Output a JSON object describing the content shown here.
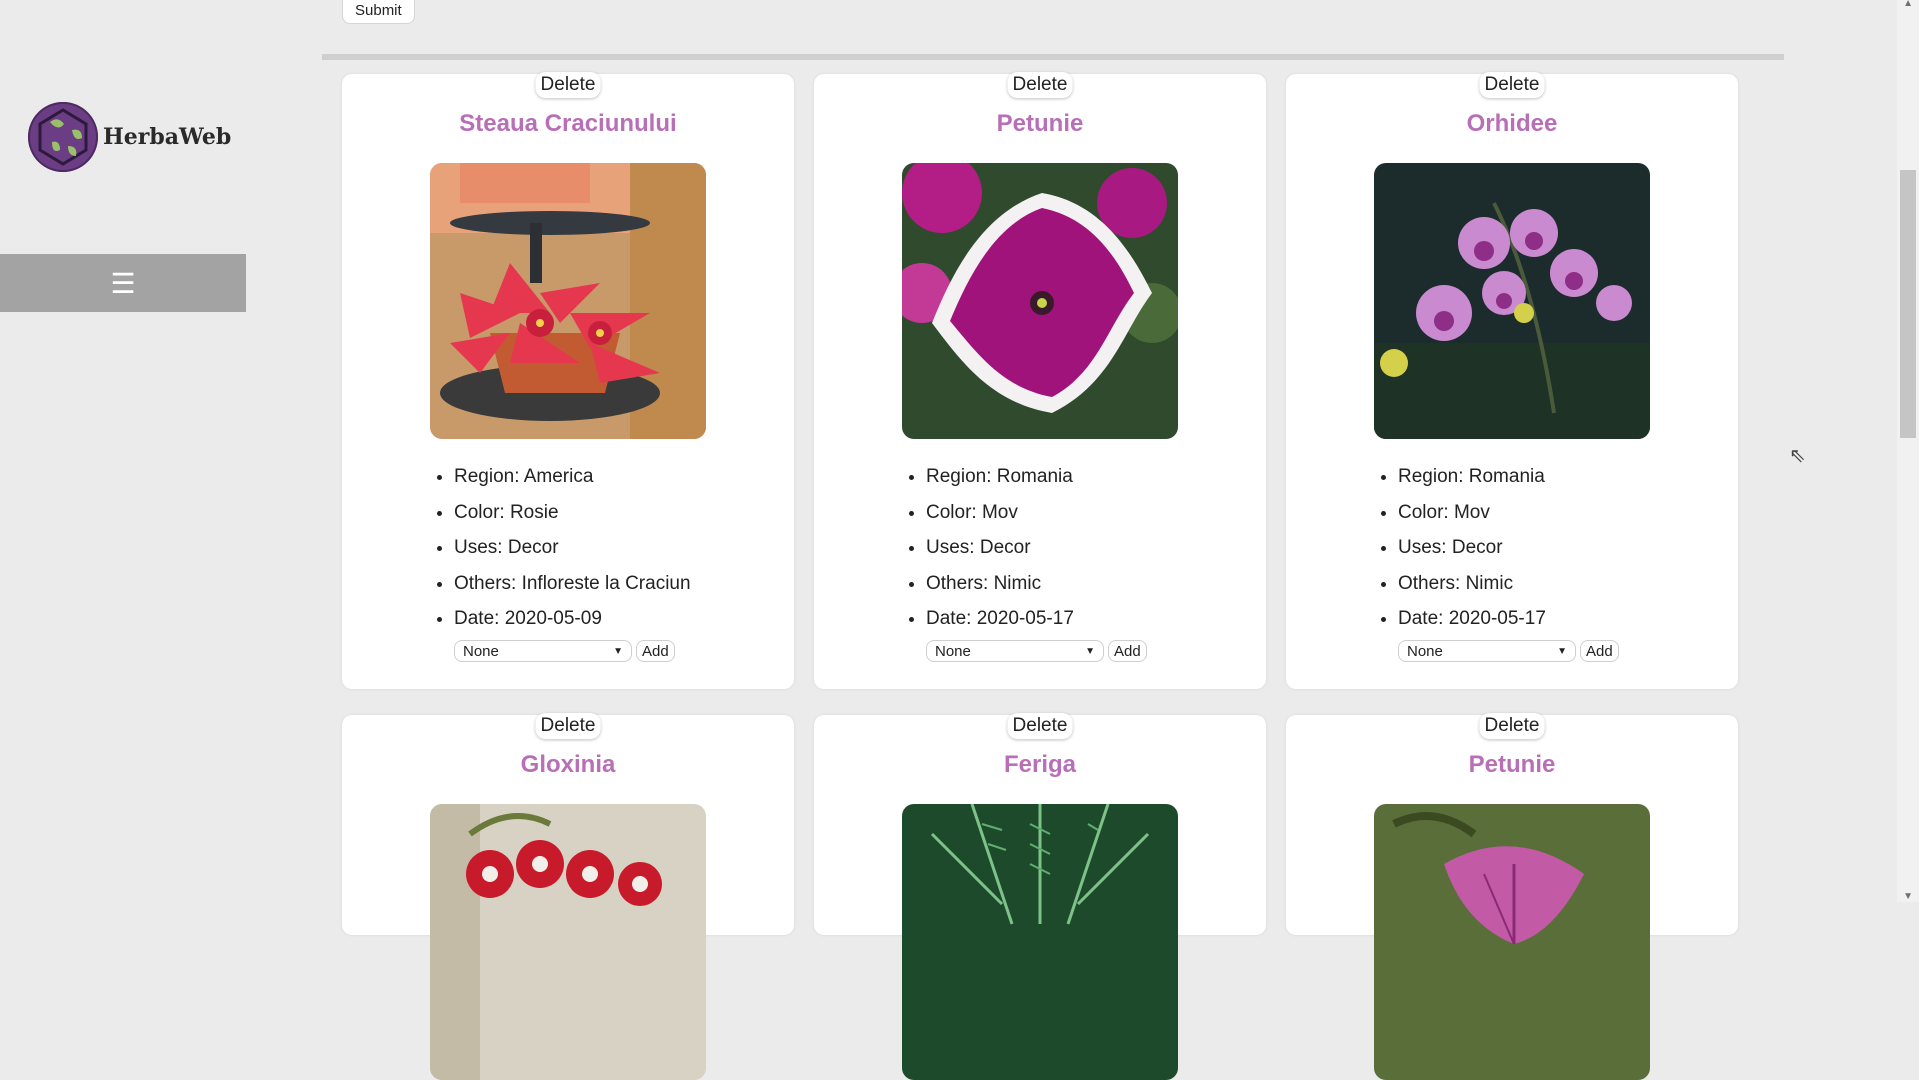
{
  "brand": {
    "name": "HerbaWeb"
  },
  "menu": {
    "icon": "hamburger-icon",
    "glyph": "☰"
  },
  "form": {
    "submit_label": "Submit"
  },
  "cards": [
    {
      "name": "Steaua Craciunului",
      "delete_label": "Delete",
      "image": "poinsettia",
      "details": [
        "Region: America",
        "Color: Rosie",
        "Uses: Decor",
        "Others: Infloreste la Craciun",
        "Date: 2020-05-09"
      ],
      "select_value": "None",
      "add_label": "Add"
    },
    {
      "name": "Petunie",
      "delete_label": "Delete",
      "image": "petunia",
      "details": [
        "Region: Romania",
        "Color: Mov",
        "Uses: Decor",
        "Others: Nimic",
        "Date: 2020-05-17"
      ],
      "select_value": "None",
      "add_label": "Add"
    },
    {
      "name": "Orhidee",
      "delete_label": "Delete",
      "image": "orchid",
      "details": [
        "Region: Romania",
        "Color: Mov",
        "Uses: Decor",
        "Others: Nimic",
        "Date: 2020-05-17"
      ],
      "select_value": "None",
      "add_label": "Add"
    },
    {
      "name": "Gloxinia",
      "delete_label": "Delete",
      "image": "gloxinia"
    },
    {
      "name": "Feriga",
      "delete_label": "Delete",
      "image": "fern"
    },
    {
      "name": "Petunie",
      "delete_label": "Delete",
      "image": "petunia-pink"
    }
  ],
  "colors": {
    "title_purple": "#b86fb7",
    "background": "#ebebeb",
    "menu_bar": "#a3a3a3",
    "logo_purple": "#6b3d84"
  }
}
